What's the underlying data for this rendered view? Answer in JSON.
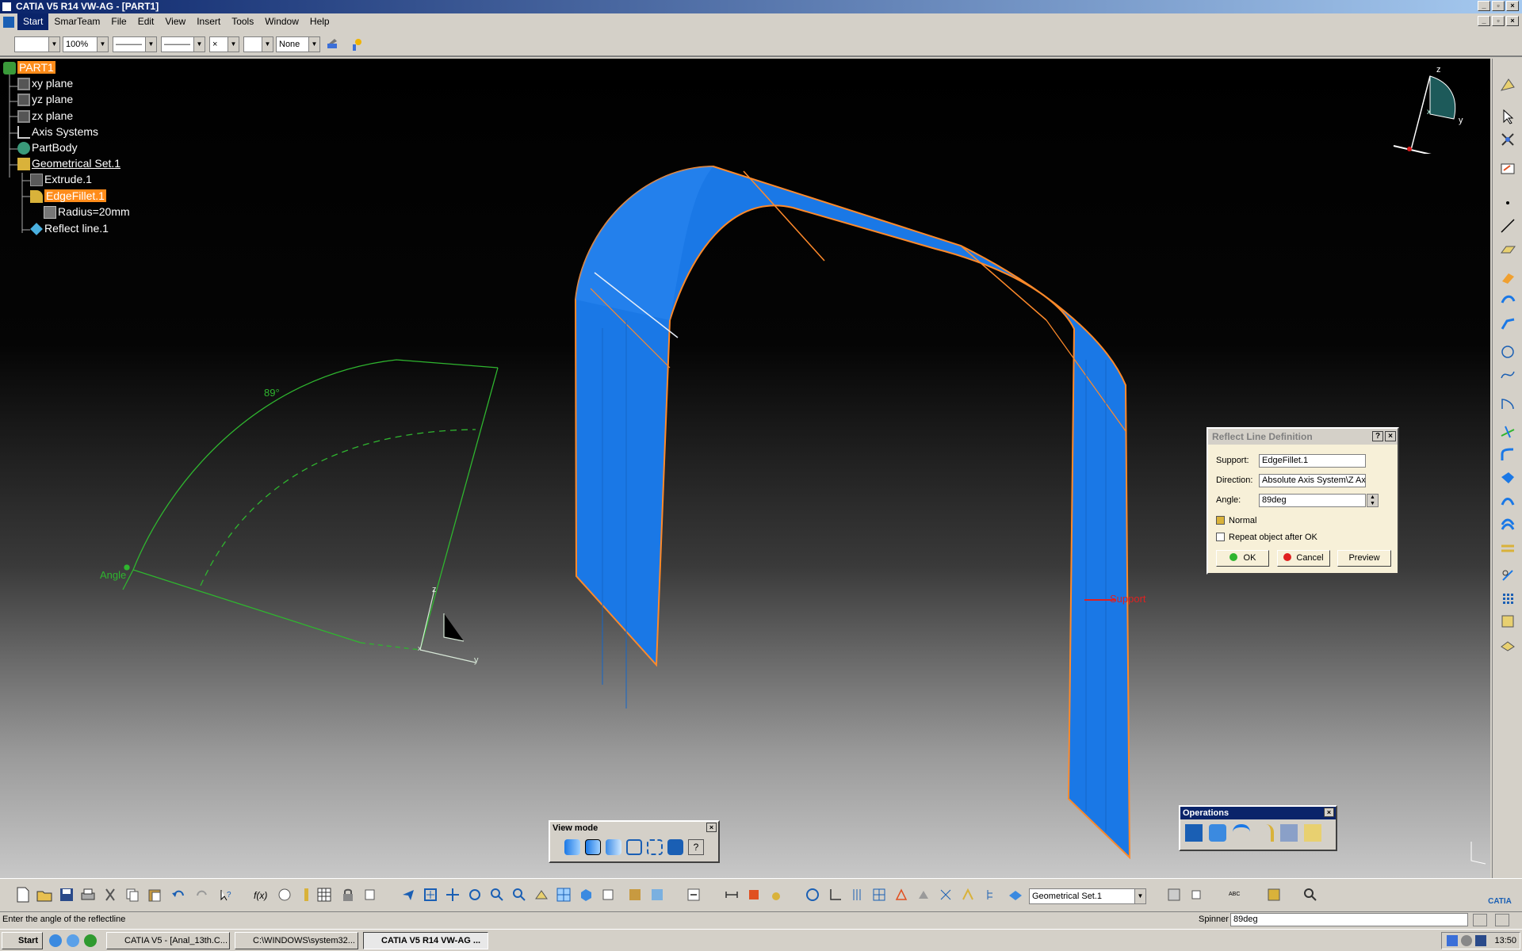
{
  "window": {
    "title": "CATIA V5 R14 VW-AG - [PART1]"
  },
  "menu": {
    "items": [
      "Start",
      "SmarTeam",
      "File",
      "Edit",
      "View",
      "Insert",
      "Tools",
      "Window",
      "Help"
    ]
  },
  "toolbar": {
    "zoom_value": "100%",
    "layer_value": "None"
  },
  "tree": {
    "root": "PART1",
    "xy": "xy plane",
    "yz": "yz plane",
    "zx": "zx plane",
    "axis": "Axis Systems",
    "partbody": "PartBody",
    "geoset": "Geometrical Set.1",
    "extrude": "Extrude.1",
    "edgefillet": "EdgeFillet.1",
    "radius": "Radius=20mm",
    "reflect": "Reflect line.1"
  },
  "viewport": {
    "angle_value": "89°",
    "angle_label": "Angle",
    "support_label": "Support",
    "axis_z": "z",
    "axis_y": "y",
    "axis_x": "x",
    "compass_z": "z",
    "compass_y": "y",
    "compass_x": "x"
  },
  "dialog": {
    "title": "Reflect Line Definition",
    "support_label": "Support:",
    "support_value": "EdgeFillet.1",
    "direction_label": "Direction:",
    "direction_value": "Absolute Axis System\\Z Axi",
    "angle_label": "Angle:",
    "angle_value": "89deg",
    "normal_label": "Normal",
    "repeat_label": "Repeat object after OK",
    "ok": "OK",
    "cancel": "Cancel",
    "preview": "Preview"
  },
  "viewmode_panel": {
    "title": "View mode"
  },
  "operations_panel": {
    "title": "Operations"
  },
  "bottom_toolbar": {
    "geoset_combo": "Geometrical Set.1"
  },
  "status": {
    "message": "Enter the angle of the reflectline",
    "spinner_label": "Spinner",
    "spinner_value": "89deg"
  },
  "taskbar": {
    "start": "Start",
    "tasks": [
      "CATIA V5 - [Anal_13th.C...",
      "C:\\WINDOWS\\system32...",
      "CATIA V5 R14 VW-AG ..."
    ],
    "clock": "13:50"
  },
  "colors": {
    "accent": "#ff8c1a",
    "surface": "#1a78e6",
    "wire": "#2fb52f"
  }
}
